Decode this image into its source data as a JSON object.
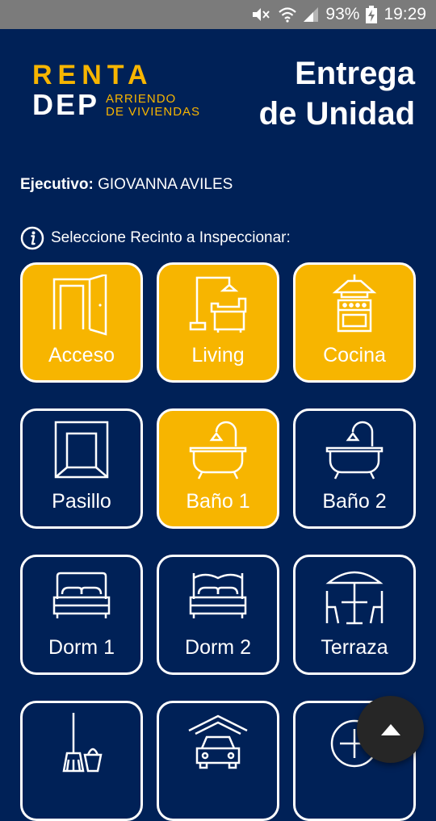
{
  "status_bar": {
    "battery": "93%",
    "time": "19:29"
  },
  "logo": {
    "line1": "RENTA",
    "line2": "DEP",
    "sub1": "ARRIENDO",
    "sub2": "DE VIVIENDAS"
  },
  "page_title": {
    "line1": "Entrega",
    "line2": "de Unidad"
  },
  "executive": {
    "label": "Ejecutivo:",
    "name": "GIOVANNA AVILES"
  },
  "instruction": "Seleccione Recinto a Inspeccionar:",
  "rooms": [
    {
      "label": "Acceso",
      "icon": "door-icon",
      "selected": true
    },
    {
      "label": "Living",
      "icon": "living-room-icon",
      "selected": true
    },
    {
      "label": "Cocina",
      "icon": "stove-icon",
      "selected": true
    },
    {
      "label": "Pasillo",
      "icon": "hallway-icon",
      "selected": false
    },
    {
      "label": "Baño 1",
      "icon": "bathtub-icon",
      "selected": true
    },
    {
      "label": "Baño 2",
      "icon": "bathtub-icon",
      "selected": false
    },
    {
      "label": "Dorm 1",
      "icon": "bed-icon",
      "selected": false
    },
    {
      "label": "Dorm 2",
      "icon": "bed-icon",
      "selected": false
    },
    {
      "label": "Terraza",
      "icon": "patio-table-icon",
      "selected": false
    },
    {
      "label": "",
      "icon": "cleaning-icon",
      "selected": false
    },
    {
      "label": "",
      "icon": "garage-car-icon",
      "selected": false
    },
    {
      "label": "",
      "icon": "add-icon",
      "selected": false
    }
  ],
  "colors": {
    "background": "#002157",
    "accent": "#f7b500",
    "statusbar": "#7b7b7b",
    "fab": "#262626"
  }
}
